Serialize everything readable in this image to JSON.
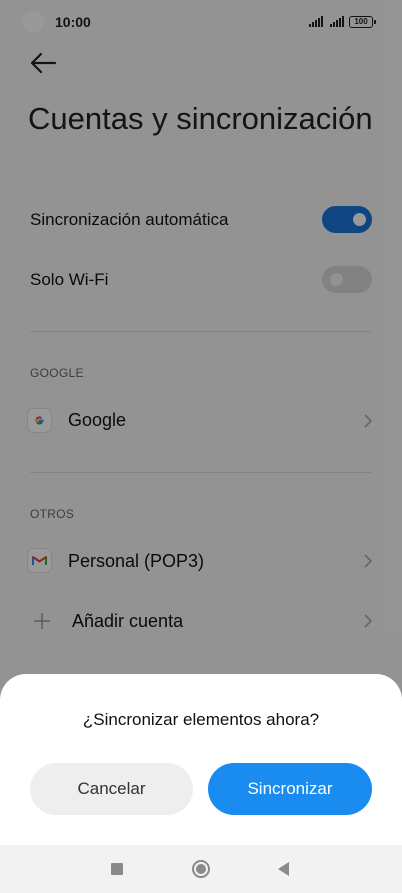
{
  "status_bar": {
    "time": "10:00",
    "battery": "100"
  },
  "page": {
    "title": "Cuentas y sincronización"
  },
  "settings": {
    "auto_sync_label": "Sincronización automática",
    "auto_sync_on": true,
    "wifi_only_label": "Solo Wi-Fi",
    "wifi_only_on": false
  },
  "google_section": {
    "header": "GOOGLE",
    "account_label": "Google"
  },
  "others_section": {
    "header": "OTROS",
    "account_label": "Personal (POP3)",
    "add_account_label": "Añadir cuenta"
  },
  "dialog": {
    "title": "¿Sincronizar elementos ahora?",
    "cancel_label": "Cancelar",
    "confirm_label": "Sincronizar"
  },
  "colors": {
    "accent": "#1a73d6",
    "confirm_button": "#1a8cf0"
  }
}
